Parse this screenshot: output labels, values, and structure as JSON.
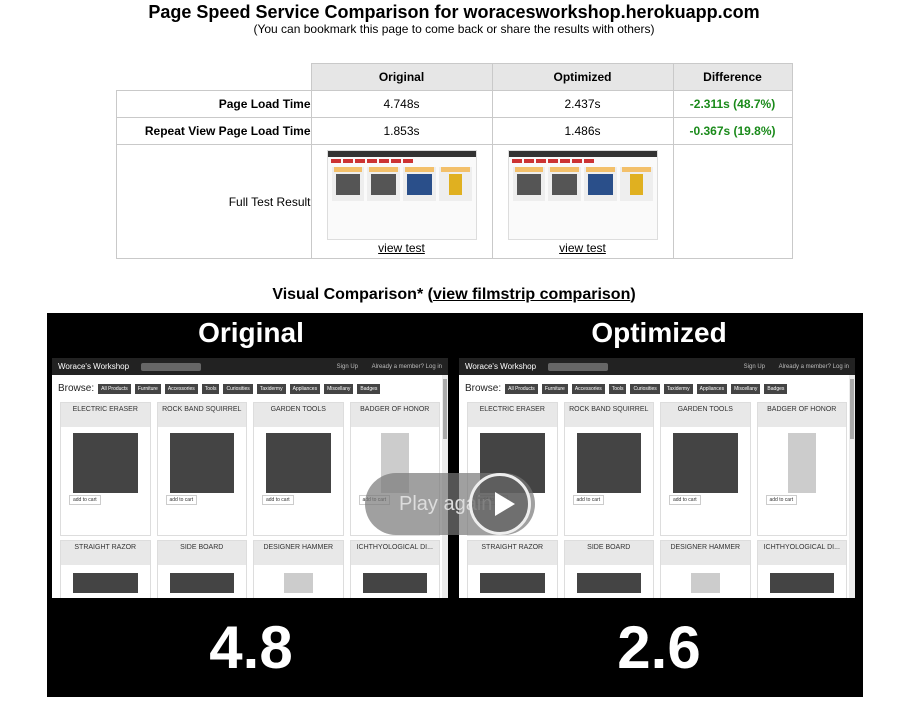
{
  "header": {
    "title": "Page Speed Service Comparison for woracesworkshop.herokuapp.com",
    "subtitle": "(You can bookmark this page to come back or share the results with others)"
  },
  "table": {
    "columns": [
      "Original",
      "Optimized",
      "Difference"
    ],
    "rows": [
      {
        "label": "Page Load Time",
        "original": "4.748s",
        "optimized": "2.437s",
        "difference": "-2.311s (48.7%)"
      },
      {
        "label": "Repeat View Page Load Time",
        "original": "1.853s",
        "optimized": "1.486s",
        "difference": "-0.367s (19.8%)"
      }
    ],
    "full_test_label": "Full Test Result",
    "view_test_label": "view test"
  },
  "visual": {
    "heading": "Visual Comparison*",
    "open_paren": " (",
    "link": "view filmstrip comparison",
    "close_paren": ")"
  },
  "player": {
    "left_title": "Original",
    "right_title": "Optimized",
    "left_score": "4.8",
    "right_score": "2.6",
    "play_label": "Play again"
  },
  "site": {
    "name": "Worace's Workshop",
    "signup": "Sign Up",
    "login": "Already a member? Log in",
    "browse": "Browse:",
    "categories": [
      "All Products",
      "Furniture",
      "Accessories",
      "Tools",
      "Curiosities",
      "Taxidermy",
      "Appliances",
      "Miscellany",
      "Badges"
    ],
    "products_row1": [
      "ELECTRIC ERASER",
      "ROCK BAND SQUIRREL",
      "GARDEN TOOLS",
      "BADGER OF HONOR"
    ],
    "products_row2": [
      "STRAIGHT RAZOR",
      "SIDE BOARD",
      "DESIGNER HAMMER",
      "ICHTHYOLOGICAL DI..."
    ],
    "add_to_cart": "add to cart"
  },
  "colors": {
    "positive": "#1a8a1a",
    "player_bg": "#000000"
  }
}
